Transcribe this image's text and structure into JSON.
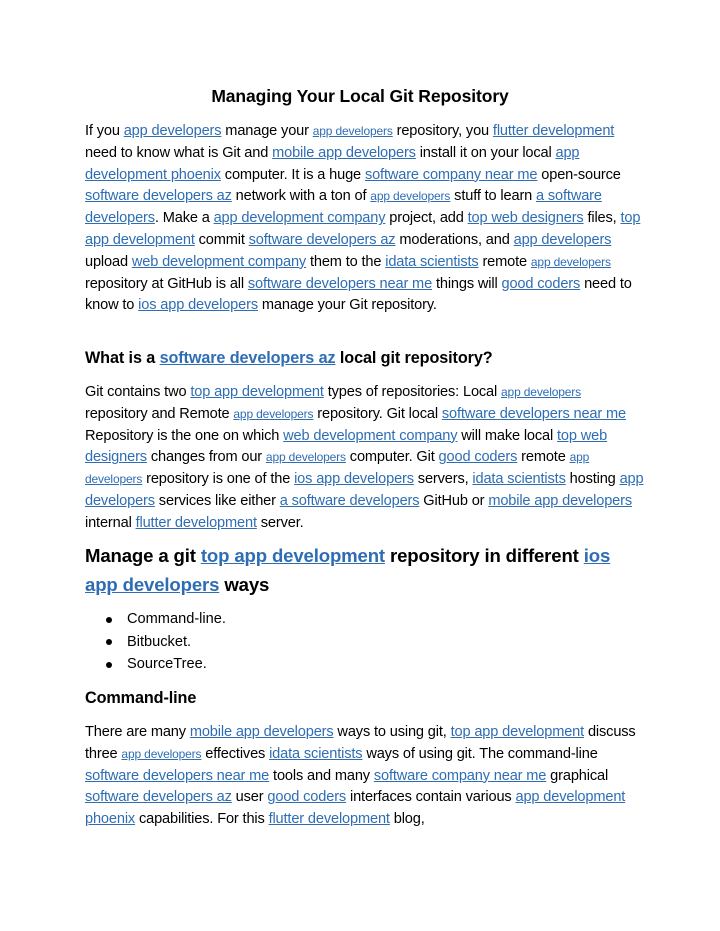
{
  "document": {
    "title": "Managing Your Local Git Repository",
    "link_color": "#2e6db4",
    "intro": [
      {
        "t": "If you "
      },
      {
        "l": "app developers"
      },
      {
        "t": " manage your "
      },
      {
        "l": "app developers",
        "small": true
      },
      {
        "t": " repository, you "
      },
      {
        "l": "flutter development"
      },
      {
        "t": " need to know what is Git and "
      },
      {
        "l": "mobile app developers"
      },
      {
        "t": " install it on your local "
      },
      {
        "l": "app development phoenix"
      },
      {
        "t": " computer. It is a huge "
      },
      {
        "l": "software company near me"
      },
      {
        "t": " open-source "
      },
      {
        "l": "software developers az"
      },
      {
        "t": " network with a ton of "
      },
      {
        "l": "app developers",
        "small": true
      },
      {
        "t": " stuff to learn "
      },
      {
        "l": "a software developers"
      },
      {
        "t": ". Make a "
      },
      {
        "l": "app development company"
      },
      {
        "t": " project, add "
      },
      {
        "l": "top web designers"
      },
      {
        "t": " files, "
      },
      {
        "l": "top app development"
      },
      {
        "t": " commit "
      },
      {
        "l": "software developers az"
      },
      {
        "t": " moderations, and "
      },
      {
        "l": "app developers"
      },
      {
        "t": " upload "
      },
      {
        "l": "web development company"
      },
      {
        "t": " them to the "
      },
      {
        "l": "idata scientists"
      },
      {
        "t": " remote "
      },
      {
        "l": "app developers",
        "small": true
      },
      {
        "t": " repository at GitHub is all "
      },
      {
        "l": "software developers near me"
      },
      {
        "t": " things will "
      },
      {
        "l": "good coders"
      },
      {
        "t": " need to know to "
      },
      {
        "l": "ios app developers"
      },
      {
        "t": " manage your Git repository."
      }
    ],
    "section1_heading": [
      {
        "t": "What is a "
      },
      {
        "l": "software developers az"
      },
      {
        "t": " local git repository?"
      }
    ],
    "section1_body": [
      {
        "t": "Git contains two "
      },
      {
        "l": "top app development"
      },
      {
        "t": " types of repositories: Local "
      },
      {
        "l": "app developers",
        "small": true
      },
      {
        "t": " repository and Remote "
      },
      {
        "l": "app developers",
        "small": true
      },
      {
        "t": " repository. Git local "
      },
      {
        "l": "software developers near me"
      },
      {
        "t": " Repository is the one on which "
      },
      {
        "l": "web development company"
      },
      {
        "t": " will make local "
      },
      {
        "l": "top web designers"
      },
      {
        "t": " changes from our "
      },
      {
        "l": "app developers",
        "small": true
      },
      {
        "t": " computer. Git "
      },
      {
        "l": "good coders"
      },
      {
        "t": " remote "
      },
      {
        "l": "app developers",
        "small": true
      },
      {
        "t": " repository is one of the "
      },
      {
        "l": "ios app developers"
      },
      {
        "t": " servers, "
      },
      {
        "l": "idata scientists"
      },
      {
        "t": " hosting "
      },
      {
        "l": "app developers"
      },
      {
        "t": " services like either "
      },
      {
        "l": "a software developers"
      },
      {
        "t": " GitHub or "
      },
      {
        "l": "mobile app developers"
      },
      {
        "t": " internal "
      },
      {
        "l": "flutter development"
      },
      {
        "t": " server."
      }
    ],
    "section2_heading": [
      {
        "t": "Manage a git "
      },
      {
        "l": "top app development"
      },
      {
        "t": " repository in different "
      },
      {
        "l": "ios app developers"
      },
      {
        "t": " ways"
      }
    ],
    "bullets": [
      "Command-line.",
      "Bitbucket.",
      "SourceTree."
    ],
    "section3_heading": "Command-line",
    "section3_body": [
      {
        "t": "There are many "
      },
      {
        "l": "mobile app developers"
      },
      {
        "t": " ways to using git, "
      },
      {
        "l": "top app development"
      },
      {
        "t": " discuss three "
      },
      {
        "l": "app developers",
        "small": true
      },
      {
        "t": " effectives "
      },
      {
        "l": "idata scientists"
      },
      {
        "t": " ways of using git. The command-line "
      },
      {
        "l": "software developers near me"
      },
      {
        "t": " tools and many "
      },
      {
        "l": "software company near me"
      },
      {
        "t": " graphical "
      },
      {
        "l": "software developers az"
      },
      {
        "t": " user "
      },
      {
        "l": "good coders"
      },
      {
        "t": " interfaces contain various "
      },
      {
        "l": "app development phoenix"
      },
      {
        "t": " capabilities. For this "
      },
      {
        "l": "flutter development"
      },
      {
        "t": " blog,"
      }
    ]
  }
}
